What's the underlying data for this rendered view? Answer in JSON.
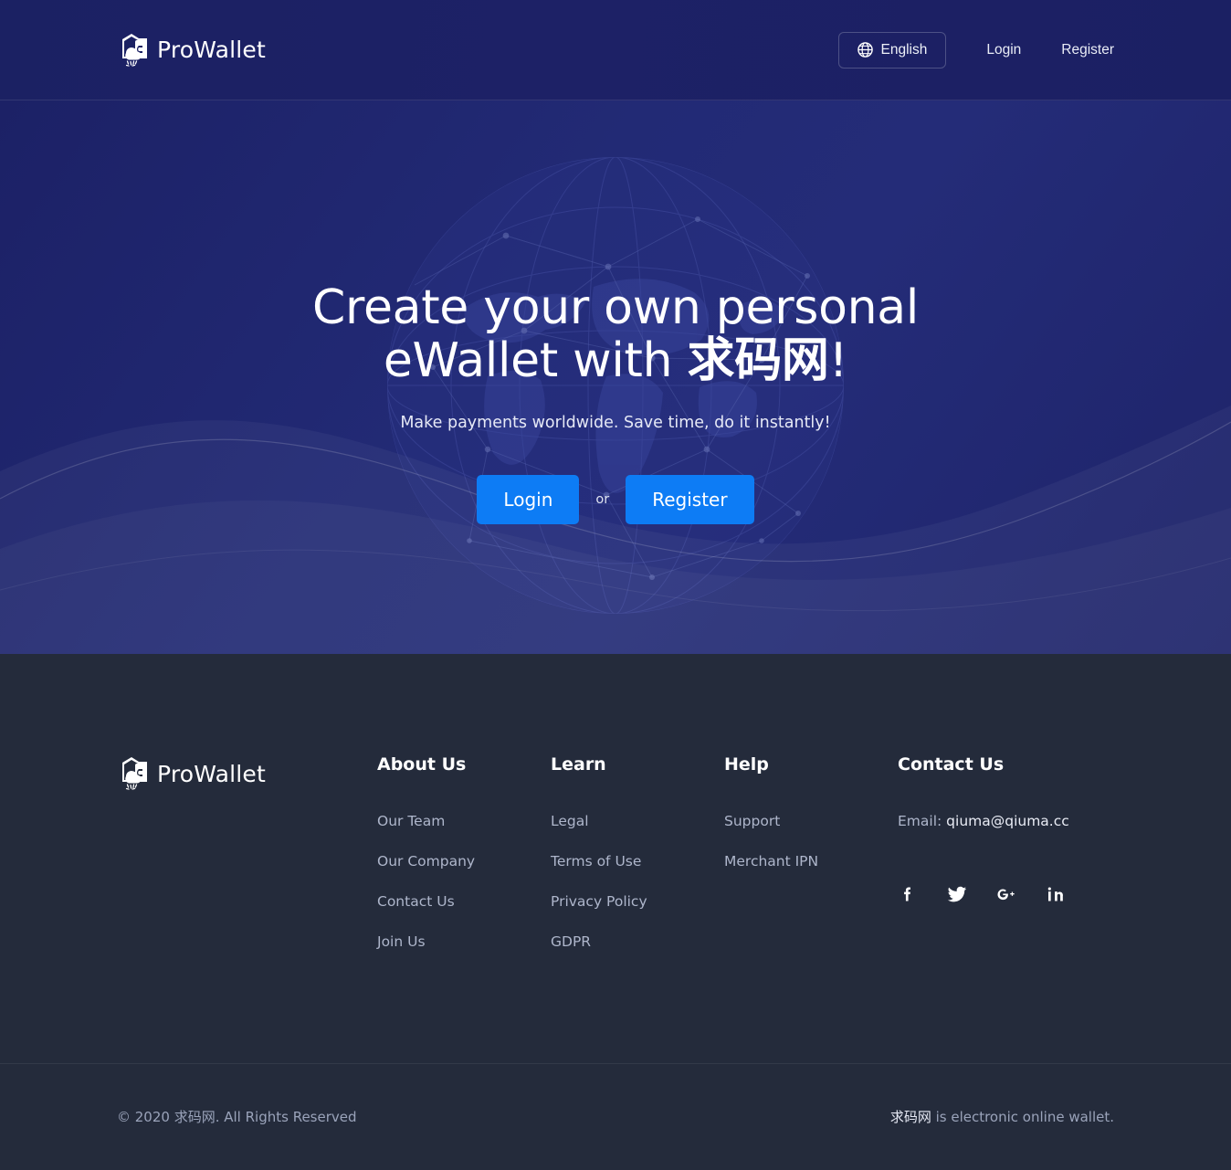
{
  "brand": {
    "name": "ProWallet",
    "logo_icon": "wallet-cloud-icon"
  },
  "header": {
    "language": {
      "label": "English",
      "icon": "globe-icon"
    },
    "login_label": "Login",
    "register_label": "Register"
  },
  "hero": {
    "title_line1": "Create your own personal",
    "title_line2_prefix": "eWallet with ",
    "title_line2_cn": "求码网",
    "title_line2_suffix": "!",
    "subtitle": "Make payments worldwide. Save time, do it instantly!",
    "login_button": "Login",
    "or_label": "or",
    "register_button": "Register",
    "background_icon": "globe-network-icon",
    "accent_color": "#0d7cf5"
  },
  "footer": {
    "columns": [
      {
        "heading": "About Us",
        "links": [
          "Our Team",
          "Our Company",
          "Contact Us",
          "Join Us"
        ]
      },
      {
        "heading": "Learn",
        "links": [
          "Legal",
          "Terms of Use",
          "Privacy Policy",
          "GDPR"
        ]
      },
      {
        "heading": "Help",
        "links": [
          "Support",
          "Merchant IPN"
        ]
      }
    ],
    "contact": {
      "heading": "Contact Us",
      "email_label": "Email:",
      "email": "qiuma@qiuma.cc"
    },
    "socials": [
      {
        "name": "facebook-icon",
        "glyph": "f"
      },
      {
        "name": "twitter-icon",
        "glyph": "t"
      },
      {
        "name": "google-plus-icon",
        "glyph": "G+"
      },
      {
        "name": "linkedin-icon",
        "glyph": "in"
      }
    ],
    "copyright": "© 2020 求码网. All Rights Reserved",
    "tagline_brand": "求码网",
    "tagline_rest": " is electronic online wallet."
  }
}
